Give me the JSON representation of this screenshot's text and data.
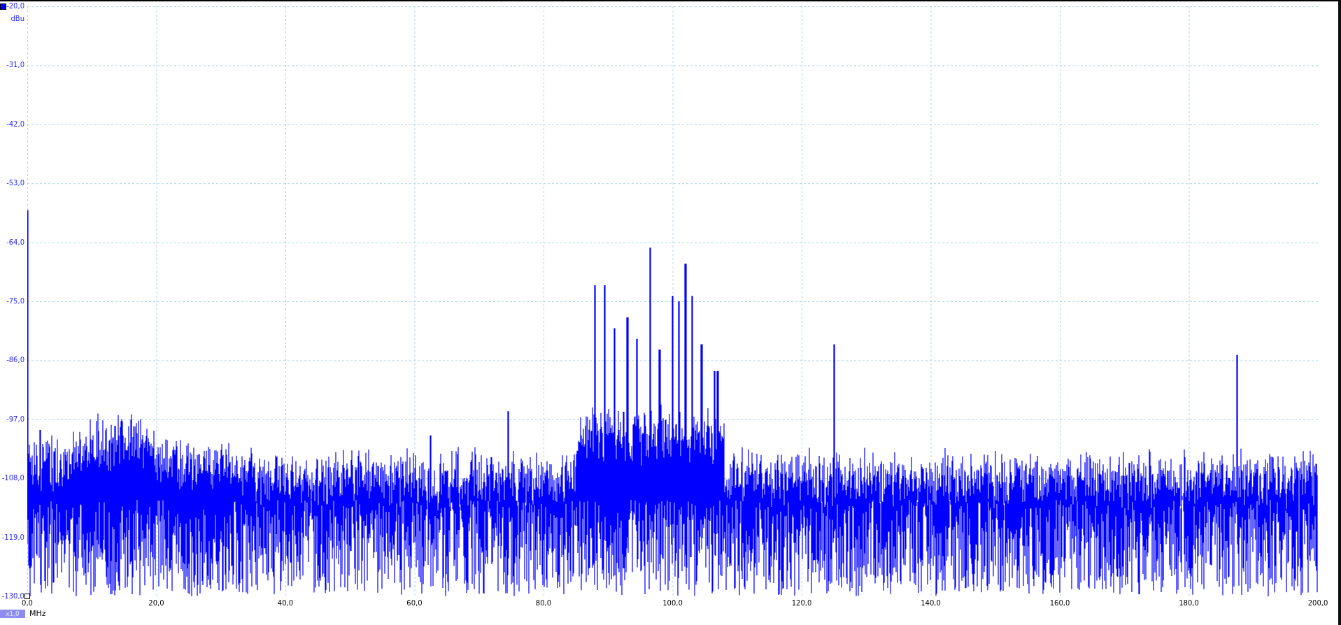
{
  "chart": {
    "y_axis": {
      "unit": "dBu",
      "ticks": [
        "-20,0",
        "-31,0",
        "-42,0",
        "-53,0",
        "-64,0",
        "-75,0",
        "-86,0",
        "-97,0",
        "-108,0",
        "-119,0",
        "-130,0"
      ]
    },
    "x_axis": {
      "unit": "MHz",
      "ticks": [
        "0,0",
        "20,0",
        "40,0",
        "60,0",
        "80,0",
        "100,0",
        "120,0",
        "140,0",
        "160,0",
        "180,0",
        "200,0"
      ]
    },
    "zoom_badge": "x1,0"
  }
}
